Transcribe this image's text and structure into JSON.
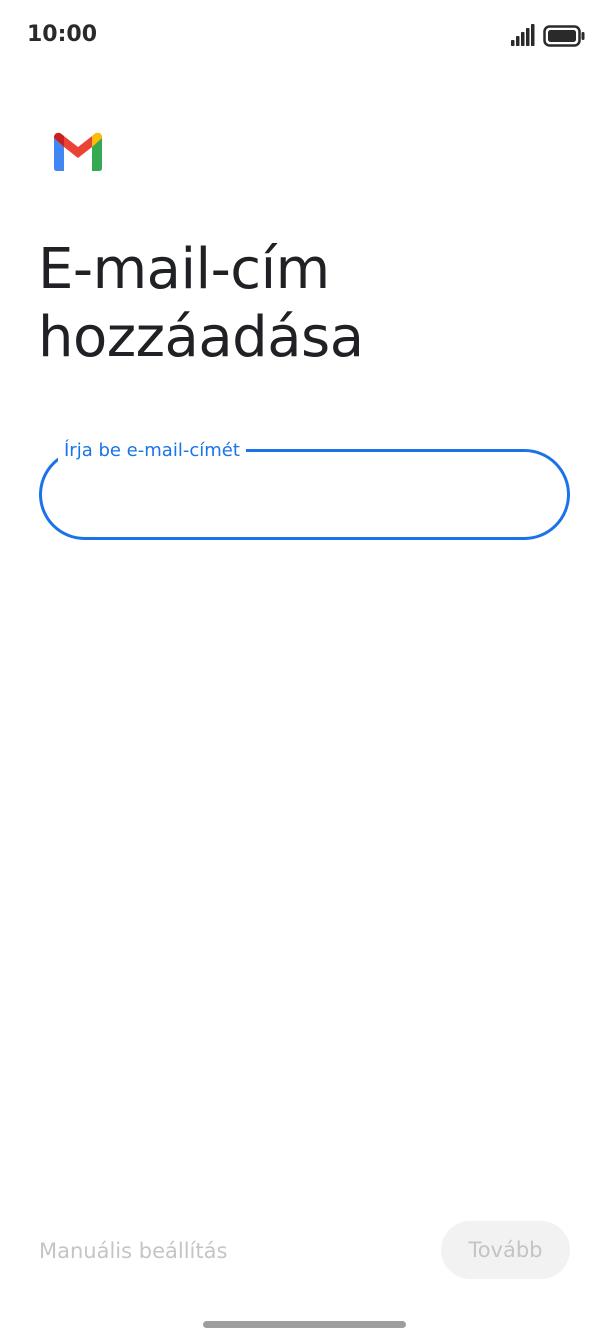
{
  "status_bar": {
    "time": "10:00",
    "signal_icon": "signal-icon",
    "battery_icon": "battery-icon"
  },
  "app": {
    "logo_icon": "gmail-logo-icon"
  },
  "page": {
    "title": "E-mail-cím hozzáadása"
  },
  "email_field": {
    "label": "Írja be e-mail-címét",
    "value": "",
    "accent_color": "#1a73e8"
  },
  "footer": {
    "manual_setup_label": "Manuális beállítás",
    "next_label": "Tovább"
  }
}
